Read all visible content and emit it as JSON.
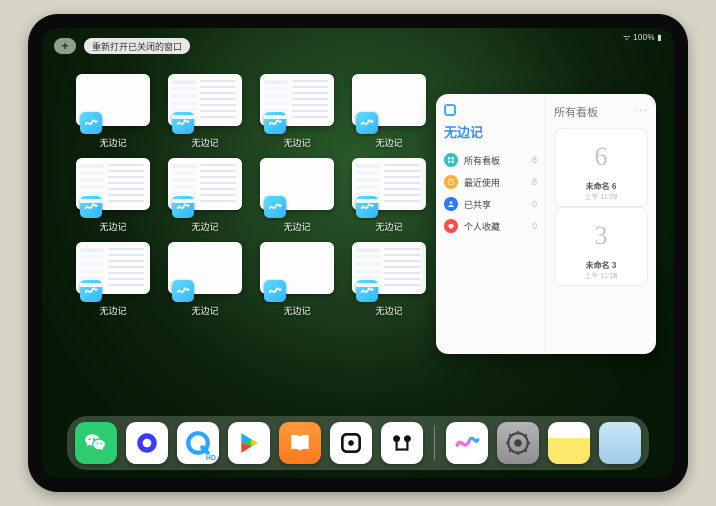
{
  "status": {
    "text": "100%"
  },
  "top": {
    "plus": "+",
    "reopen_label": "重新打开已关闭的窗口"
  },
  "app_switcher": {
    "app_name": "无边记",
    "windows": [
      {
        "label": "无边记",
        "content": false
      },
      {
        "label": "无边记",
        "content": true
      },
      {
        "label": "无边记",
        "content": true
      },
      {
        "label": "无边记",
        "content": false
      },
      {
        "label": "无边记",
        "content": true
      },
      {
        "label": "无边记",
        "content": true
      },
      {
        "label": "无边记",
        "content": false
      },
      {
        "label": "无边记",
        "content": true
      },
      {
        "label": "无边记",
        "content": true
      },
      {
        "label": "无边记",
        "content": false
      },
      {
        "label": "无边记",
        "content": false
      },
      {
        "label": "无边记",
        "content": true
      }
    ]
  },
  "side_panel": {
    "left": {
      "title": "无边记",
      "items": [
        {
          "icon": "grid",
          "color": "#35c0c9",
          "label": "所有看板",
          "count": "8"
        },
        {
          "icon": "clock",
          "color": "#ffb02e",
          "label": "最近使用",
          "count": "8"
        },
        {
          "icon": "person",
          "color": "#2e7bff",
          "label": "已共享",
          "count": "0"
        },
        {
          "icon": "heart",
          "color": "#ff4d4d",
          "label": "个人收藏",
          "count": "0"
        }
      ]
    },
    "right": {
      "title": "所有看板",
      "more": "···",
      "boards": [
        {
          "glyph": "6",
          "name": "未命名 6",
          "time": "上午 11:28"
        },
        {
          "glyph": "3",
          "name": "未命名 3",
          "time": "上午 11:28"
        }
      ]
    }
  },
  "dock": {
    "icons": [
      {
        "name": "wechat",
        "label": "微信"
      },
      {
        "name": "quark",
        "label": "Q"
      },
      {
        "name": "qqbrowser",
        "label": "Q"
      },
      {
        "name": "play",
        "label": "Play"
      },
      {
        "name": "books",
        "label": "图书"
      },
      {
        "name": "dotpad",
        "label": "Dot"
      },
      {
        "name": "music",
        "label": "Music"
      },
      {
        "name": "freeform",
        "label": "无边记"
      },
      {
        "name": "settings",
        "label": "设置"
      },
      {
        "name": "notes",
        "label": "备忘录"
      },
      {
        "name": "app-library",
        "label": "App资源库"
      }
    ]
  }
}
